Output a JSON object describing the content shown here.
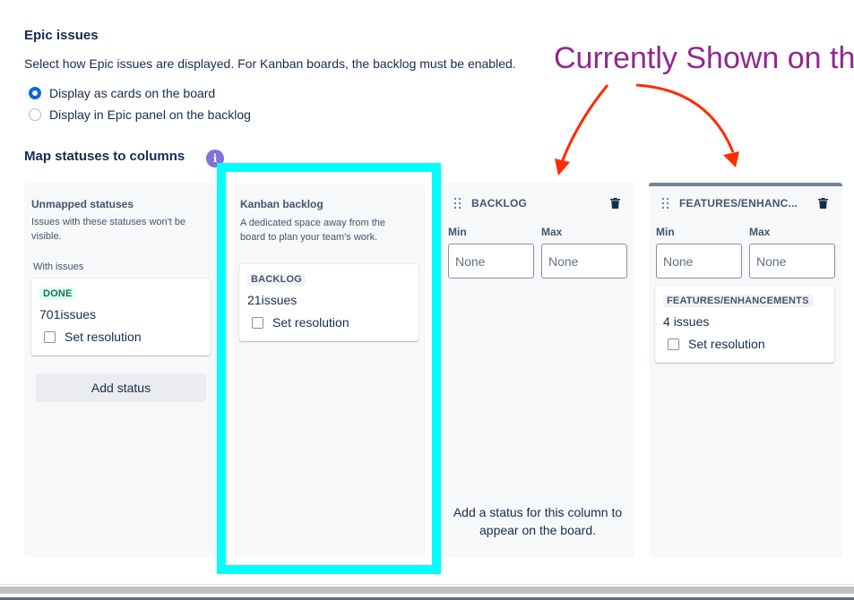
{
  "epic": {
    "heading": "Epic issues",
    "description": "Select how Epic issues are displayed. For Kanban boards, the backlog must be enabled.",
    "options": [
      {
        "label": "Display as cards on the board",
        "selected": true
      },
      {
        "label": "Display in Epic panel on the backlog",
        "selected": false
      }
    ]
  },
  "map": {
    "heading": "Map statuses to columns",
    "info_icon": "i"
  },
  "unmapped": {
    "title": "Unmapped statuses",
    "subtitle": "Issues with these statuses won't be visible.",
    "group_label": "With issues",
    "status": {
      "lozenge": "DONE",
      "count": "701",
      "count_suffix": "issues",
      "resolution_label": "Set resolution"
    },
    "add_status_label": "Add status"
  },
  "kanban_backlog": {
    "title": "Kanban backlog",
    "subtitle": "A dedicated space away from the board to plan your team's work.",
    "status": {
      "lozenge": "BACKLOG",
      "count": "21",
      "count_suffix": "issues",
      "resolution_label": "Set resolution"
    }
  },
  "columns": [
    {
      "title": "BACKLOG",
      "min_label": "Min",
      "max_label": "Max",
      "min_placeholder": "None",
      "max_placeholder": "None",
      "empty_message": "Add a status for this column to appear on the board."
    },
    {
      "title": "FEATURES/ENHANC...",
      "min_label": "Min",
      "max_label": "Max",
      "min_placeholder": "None",
      "max_placeholder": "None",
      "status": {
        "lozenge": "FEATURES/ENHANCEMENTS",
        "count": "4",
        "count_suffix": "issues",
        "resolution_label": "Set resolution"
      }
    }
  ],
  "annotation": {
    "text": "Currently Shown on the",
    "color": "#92278f",
    "arrow_color": "#ff2a00",
    "highlight_color": "#00ffff"
  }
}
